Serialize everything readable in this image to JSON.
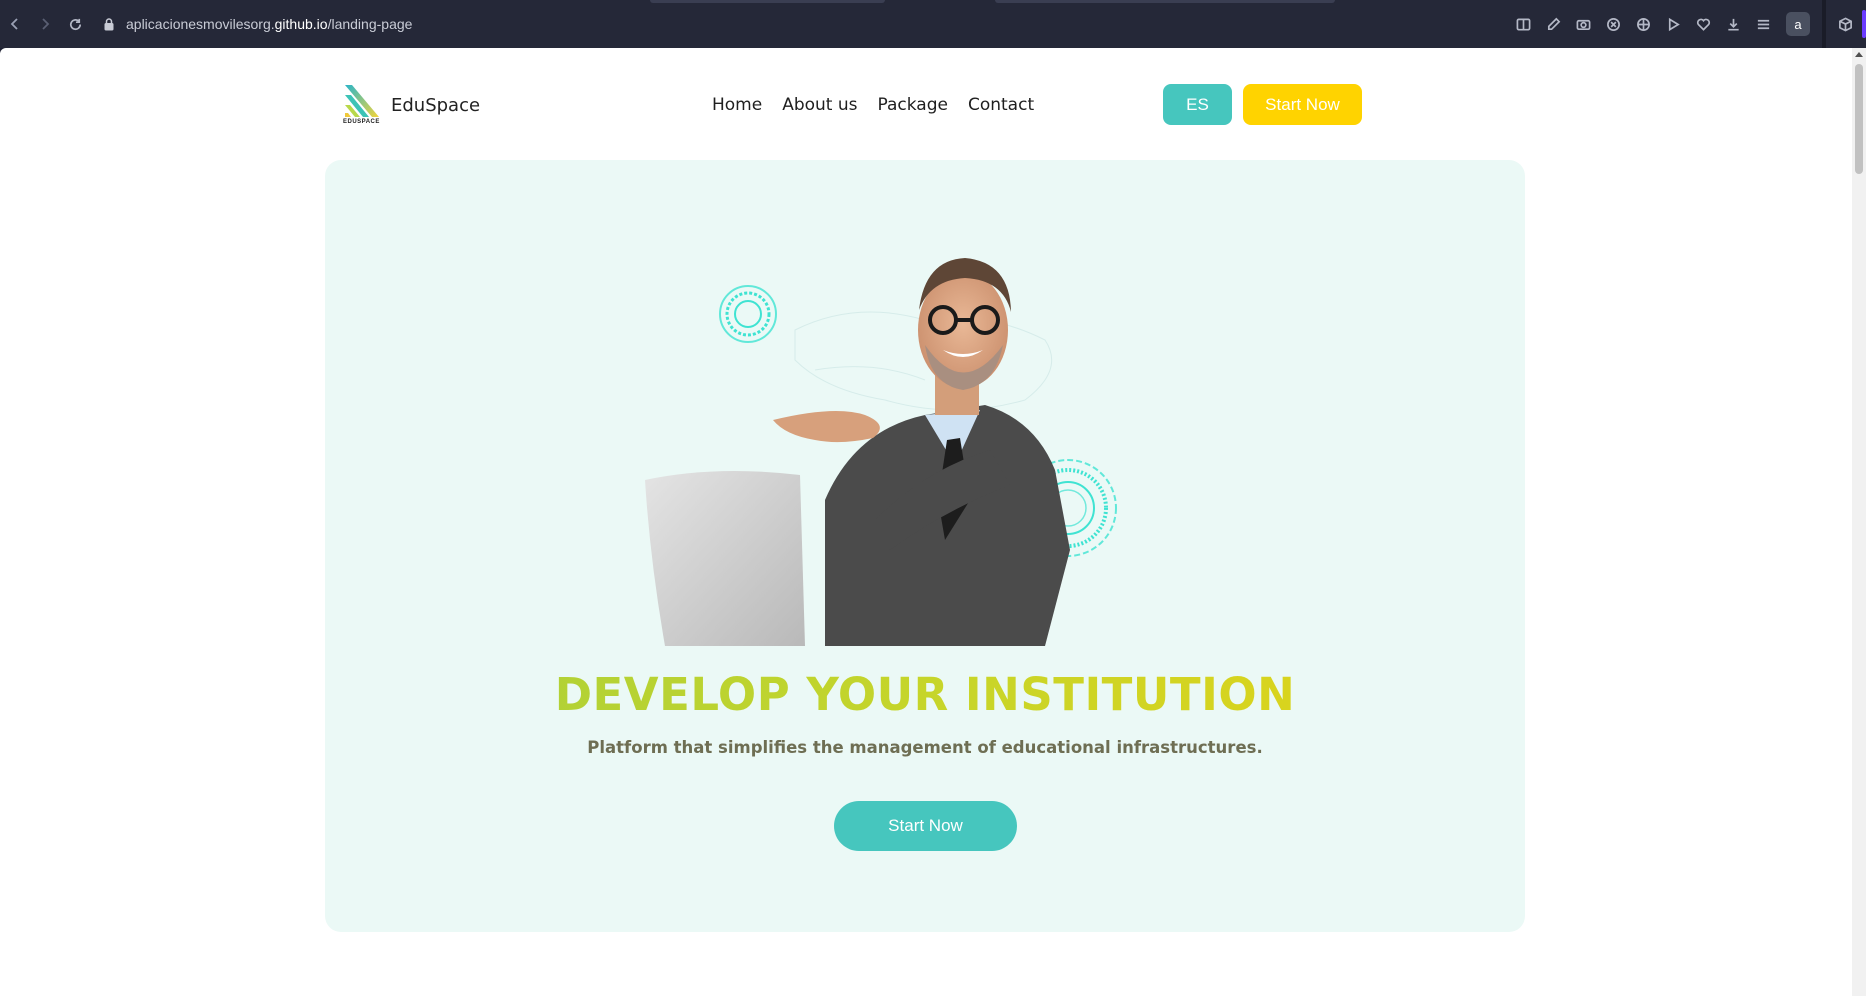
{
  "browser": {
    "url_prefix": "aplicacionesmovilesorg.",
    "url_host": "github.io",
    "url_path": "/landing-page",
    "profile_initial": "a"
  },
  "header": {
    "brand_name": "EduSpace",
    "logo_caption": "EDUSPACE",
    "nav": [
      "Home",
      "About us",
      "Package",
      "Contact"
    ],
    "lang_label": "ES",
    "start_label": "Start Now"
  },
  "hero": {
    "title": "DEVELOP YOUR INSTITUTION",
    "subtitle": "Platform that simplifies the management of educational infrastructures.",
    "cta_label": "Start Now"
  },
  "colors": {
    "teal": "#46c6be",
    "yellow": "#ffd300",
    "hero_bg": "#ebf9f6",
    "title_gradient_start": "#a7cf3c",
    "title_gradient_end": "#e4d316"
  }
}
